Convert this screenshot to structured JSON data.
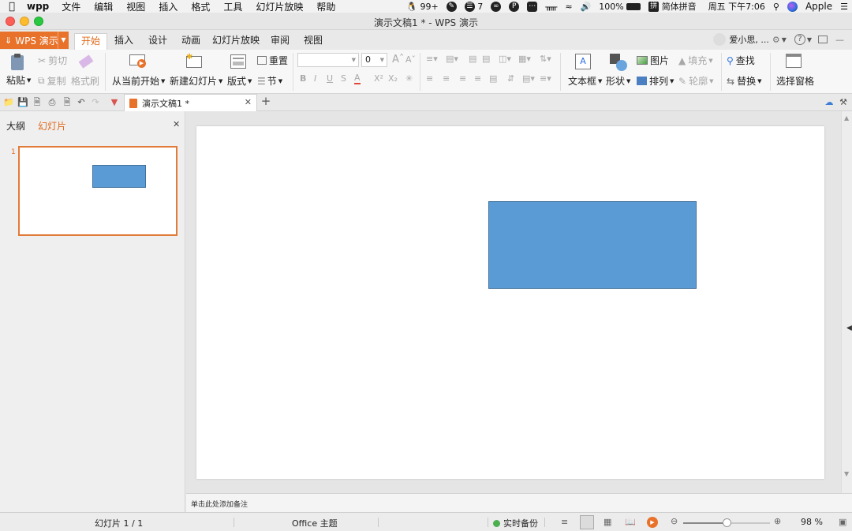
{
  "menubar": {
    "app": "wpp",
    "items": [
      "文件",
      "编辑",
      "视图",
      "插入",
      "格式",
      "工具",
      "幻灯片放映",
      "帮助"
    ],
    "status": {
      "qq_count": "99+",
      "notes_count": "7",
      "battery": "100%",
      "input_method": "简体拼音",
      "datetime": "周五 下午7:06",
      "user": "Apple"
    }
  },
  "window": {
    "title": "演示文稿1 * - WPS 演示"
  },
  "ribbon_tabs": {
    "wps_button": "WPS 演示",
    "tabs": [
      "开始",
      "插入",
      "设计",
      "动画",
      "幻灯片放映",
      "审阅",
      "视图"
    ],
    "active": "开始",
    "user_name": "爱小思, ..."
  },
  "ribbon": {
    "paste": "粘贴",
    "cut": "剪切",
    "copy": "复制",
    "format_painter": "格式刷",
    "play_from_current": "从当前开始",
    "new_slide": "新建幻灯片",
    "layout": "版式",
    "reset": "重置",
    "section": "节",
    "font_size_value": "0",
    "textbox": "文本框",
    "shape": "形状",
    "picture": "图片",
    "fill": "填充",
    "arrange": "排列",
    "outline": "轮廓",
    "find": "查找",
    "replace": "替换",
    "select_pane": "选择窗格"
  },
  "doc_tab": {
    "name": "演示文稿1 *"
  },
  "left_pane": {
    "tab_outline": "大纲",
    "tab_slides": "幻灯片",
    "slide_number": "1"
  },
  "notes": {
    "placeholder": "单击此处添加备注"
  },
  "statusbar": {
    "slide_info": "幻灯片 1 / 1",
    "theme": "Office 主题",
    "backup": "实时备份",
    "zoom": "98 %",
    "zoom_level": 0.5
  },
  "colors": {
    "accent": "#e8722a",
    "shape_fill": "#5b9bd5",
    "shape_border": "#41719c",
    "backup_dot": "#4caf50"
  }
}
